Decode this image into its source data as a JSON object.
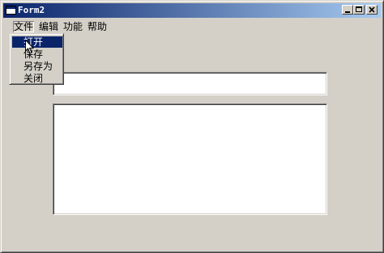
{
  "window": {
    "title": "Form2",
    "icon": "app-window-icon",
    "buttons": [
      "minimize-icon",
      "maximize-icon",
      "close-icon"
    ]
  },
  "menubar": {
    "items": [
      {
        "label": "文件",
        "active": true
      },
      {
        "label": "编辑"
      },
      {
        "label": "功能"
      },
      {
        "label": "帮助"
      }
    ]
  },
  "file_menu": {
    "items": [
      {
        "label": "打开",
        "selected": true
      },
      {
        "label": "保存"
      },
      {
        "label": "另存为"
      },
      {
        "label": "关闭"
      }
    ]
  },
  "textbox": {
    "value": ""
  },
  "textarea": {
    "value": ""
  },
  "colors": {
    "face": "#d4d0c8",
    "title_start": "#0a246a",
    "title_end": "#a6caf0",
    "highlight": "#0a246a"
  }
}
